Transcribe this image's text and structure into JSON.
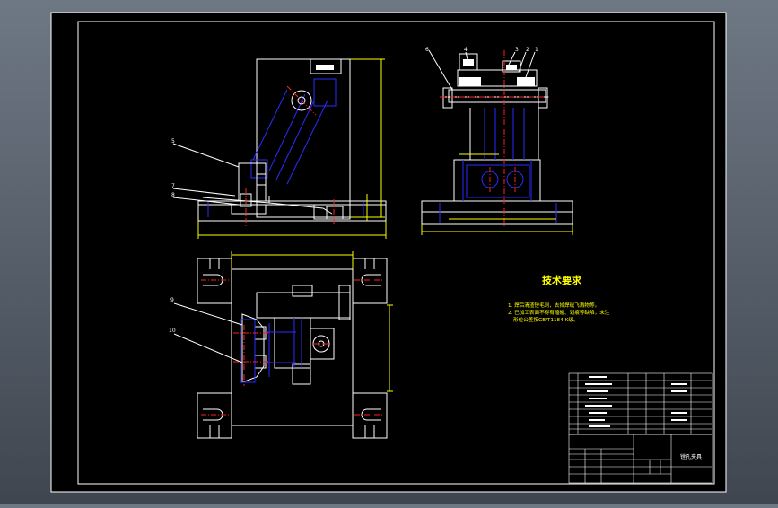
{
  "colors": {
    "background": "#000000",
    "frame": "#ffffff",
    "part": "#ffffff",
    "hidden": "#2b2bff",
    "centerline": "#ff2020",
    "dimension": "#ffff00",
    "title_block": "#ffffff"
  },
  "balloons": {
    "front": [
      "5",
      "7",
      "8"
    ],
    "side": [
      "6",
      "4",
      "3",
      "2",
      "1"
    ],
    "top": [
      "9",
      "10"
    ]
  },
  "notes": {
    "title": "技术要求",
    "line1": "1. 焊后清渣锉毛刺，去掉焊缝飞溅物等。",
    "line2": "2. 已加工表面不得有磕碰、划痕等缺陷，未注",
    "line3": "形位公差按GB/T1184-K级。"
  },
  "title_block": {
    "drawing_name": "镗孔夹具"
  }
}
